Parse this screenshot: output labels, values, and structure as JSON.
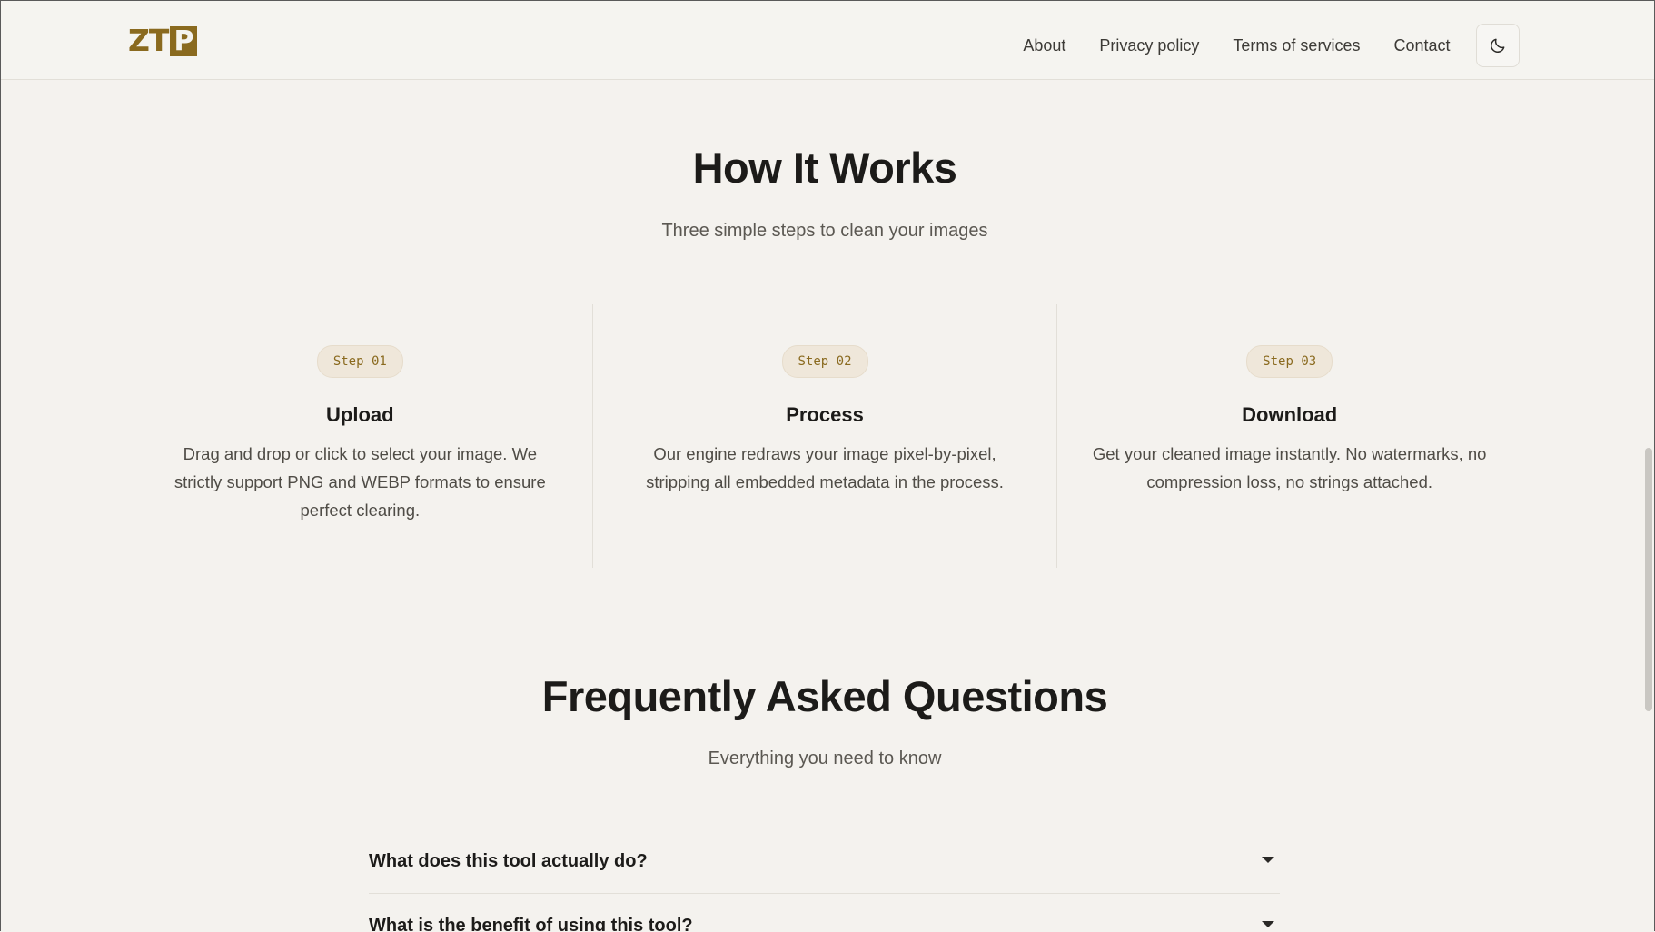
{
  "header": {
    "logo": {
      "text_left": "ZT",
      "text_box": "P"
    },
    "nav": [
      {
        "label": "About"
      },
      {
        "label": "Privacy policy"
      },
      {
        "label": "Terms of services"
      },
      {
        "label": "Contact"
      }
    ],
    "theme_toggle_icon": "moon-icon"
  },
  "how_it_works": {
    "title": "How It Works",
    "subtitle": "Three simple steps to clean your images",
    "steps": [
      {
        "badge": "Step 01",
        "title": "Upload",
        "description": "Drag and drop or click to select your image. We strictly support PNG and WEBP formats to ensure perfect clearing."
      },
      {
        "badge": "Step 02",
        "title": "Process",
        "description": "Our engine redraws your image pixel-by-pixel, stripping all embedded metadata in the process."
      },
      {
        "badge": "Step 03",
        "title": "Download",
        "description": "Get your cleaned image instantly. No watermarks, no compression loss, no strings attached."
      }
    ]
  },
  "faq": {
    "title": "Frequently Asked Questions",
    "subtitle": "Everything you need to know",
    "items": [
      {
        "question": "What does this tool actually do?"
      },
      {
        "question": "What is the benefit of using this tool?"
      }
    ]
  },
  "colors": {
    "background": "#f4f2ee",
    "accent": "#8a6a1f",
    "badge_bg": "#efe7da",
    "text": "#1c1b19"
  }
}
